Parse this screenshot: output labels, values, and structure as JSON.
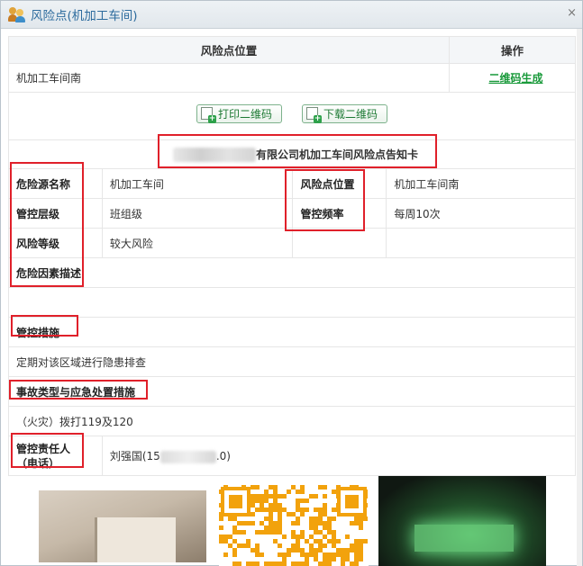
{
  "window": {
    "title": "风险点(机加工车间)",
    "icon": "users-icon",
    "close": "×"
  },
  "top_table": {
    "headers": [
      "风险点位置",
      "操作"
    ],
    "row": {
      "location": "机加工车间南",
      "action": "二维码生成"
    }
  },
  "buttons": {
    "print": "打印二维码",
    "download": "下载二维码"
  },
  "card": {
    "title_suffix": "有限公司机加工车间风险点告知卡",
    "hazard_source_label": "危险源名称",
    "hazard_source_value": "机加工车间",
    "risk_location_label": "风险点位置",
    "risk_location_value": "机加工车间南",
    "control_level_label": "管控层级",
    "control_level_value": "班组级",
    "control_freq_label": "管控频率",
    "control_freq_value": "每周10次",
    "risk_level_label": "风险等级",
    "risk_level_value": "较大风险",
    "risk_factor_label": "危险因素描述",
    "measures_label": "管控措施",
    "measures_value": "定期对该区域进行隐患排查",
    "accident_label": "事故类型与应急处置措施",
    "accident_value": "（火灾）拨打119及120",
    "person_label_1": "管控责任人",
    "person_label_2": "（电话）",
    "person_value_prefix": "刘强国(15",
    "person_value_suffix": ".0)"
  },
  "colors": {
    "accent": "#2e6c9e",
    "link_green": "#1a9a3b",
    "highlight": "#e0202a"
  }
}
